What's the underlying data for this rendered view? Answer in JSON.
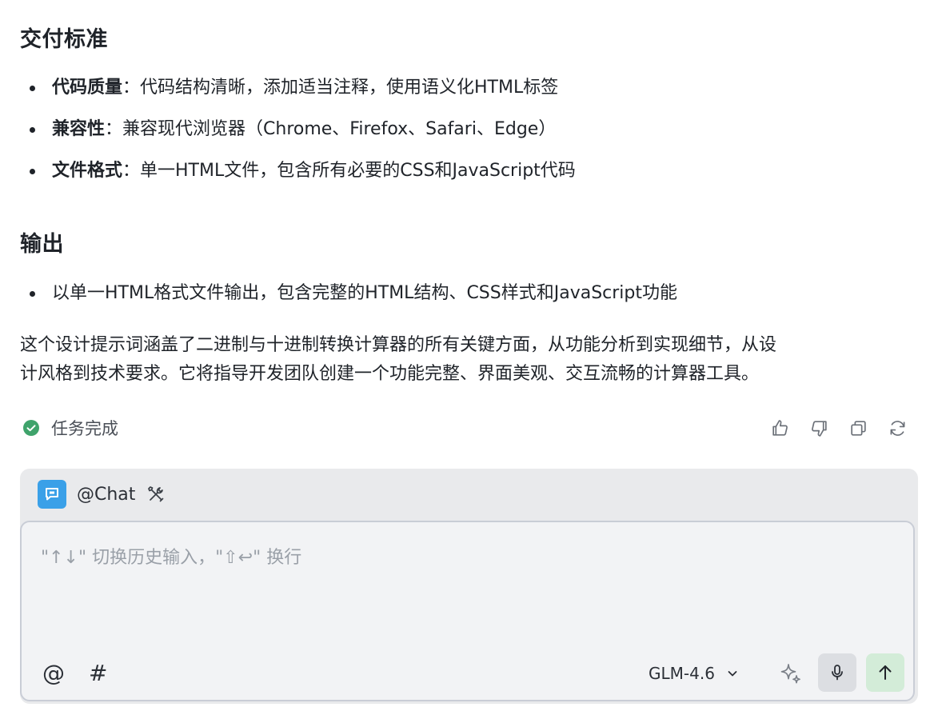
{
  "sections": {
    "delivery_title": "交付标准",
    "delivery_items": [
      {
        "term": "代码质量",
        "text": "：代码结构清晰，添加适当注释，使用语义化HTML标签"
      },
      {
        "term": "兼容性",
        "text": "：兼容现代浏览器（Chrome、Firefox、Safari、Edge）"
      },
      {
        "term": "文件格式",
        "text": "：单一HTML文件，包含所有必要的CSS和JavaScript代码"
      }
    ],
    "output_title": "输出",
    "output_items": [
      {
        "text": "以单一HTML格式文件输出，包含完整的HTML结构、CSS样式和JavaScript功能"
      }
    ],
    "summary_line1": "这个设计提示词涵盖了二进制与十进制转换计算器的所有关键方面，从功能分析到实现细节，从设",
    "summary_line2": "计风格到技术要求。它将指导开发团队创建一个功能完整、界面美观、交互流畅的计算器工具。"
  },
  "status": {
    "text": "任务完成",
    "color": "#3fa36b",
    "actions": [
      "thumbs-up-icon",
      "thumbs-down-icon",
      "copy-icon",
      "refresh-icon"
    ]
  },
  "composer": {
    "agent_name": "@Chat",
    "agent_color": "#3aa0e8",
    "placeholder": "\"↑↓\" 切换历史输入，\"⇧↩\" 换行",
    "at_label": "@",
    "hash_label": "#",
    "model": "GLM-4.6",
    "send_color": "#d3ecd8"
  }
}
